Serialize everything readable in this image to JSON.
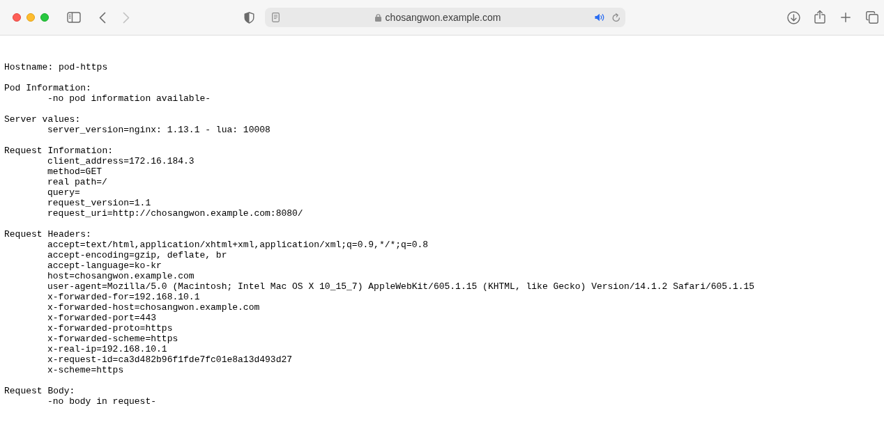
{
  "toolbar": {
    "nav_buttons": [
      {
        "kind": "back",
        "disabled": false
      },
      {
        "kind": "forward",
        "disabled": true
      }
    ],
    "url": "chosangwon.example.com"
  },
  "page": {
    "hostname": "Hostname: pod-https",
    "sections": [
      {
        "heading": "Pod Information:",
        "lines": [
          "-no pod information available-"
        ]
      },
      {
        "heading": "Server values:",
        "lines": [
          "server_version=nginx: 1.13.1 - lua: 10008"
        ]
      },
      {
        "heading": "Request Information:",
        "lines": [
          "client_address=172.16.184.3",
          "method=GET",
          "real path=/",
          "query=",
          "request_version=1.1",
          "request_uri=http://chosangwon.example.com:8080/"
        ]
      },
      {
        "heading": "Request Headers:",
        "lines": [
          "accept=text/html,application/xhtml+xml,application/xml;q=0.9,*/*;q=0.8",
          "accept-encoding=gzip, deflate, br",
          "accept-language=ko-kr",
          "host=chosangwon.example.com",
          "user-agent=Mozilla/5.0 (Macintosh; Intel Mac OS X 10_15_7) AppleWebKit/605.1.15 (KHTML, like Gecko) Version/14.1.2 Safari/605.1.15",
          "x-forwarded-for=192.168.10.1",
          "x-forwarded-host=chosangwon.example.com",
          "x-forwarded-port=443",
          "x-forwarded-proto=https",
          "x-forwarded-scheme=https",
          "x-real-ip=192.168.10.1",
          "x-request-id=ca3d482b96f1fde7fc01e8a13d493d27",
          "x-scheme=https"
        ]
      },
      {
        "heading": "Request Body:",
        "lines": [
          "-no body in request-"
        ]
      }
    ]
  }
}
